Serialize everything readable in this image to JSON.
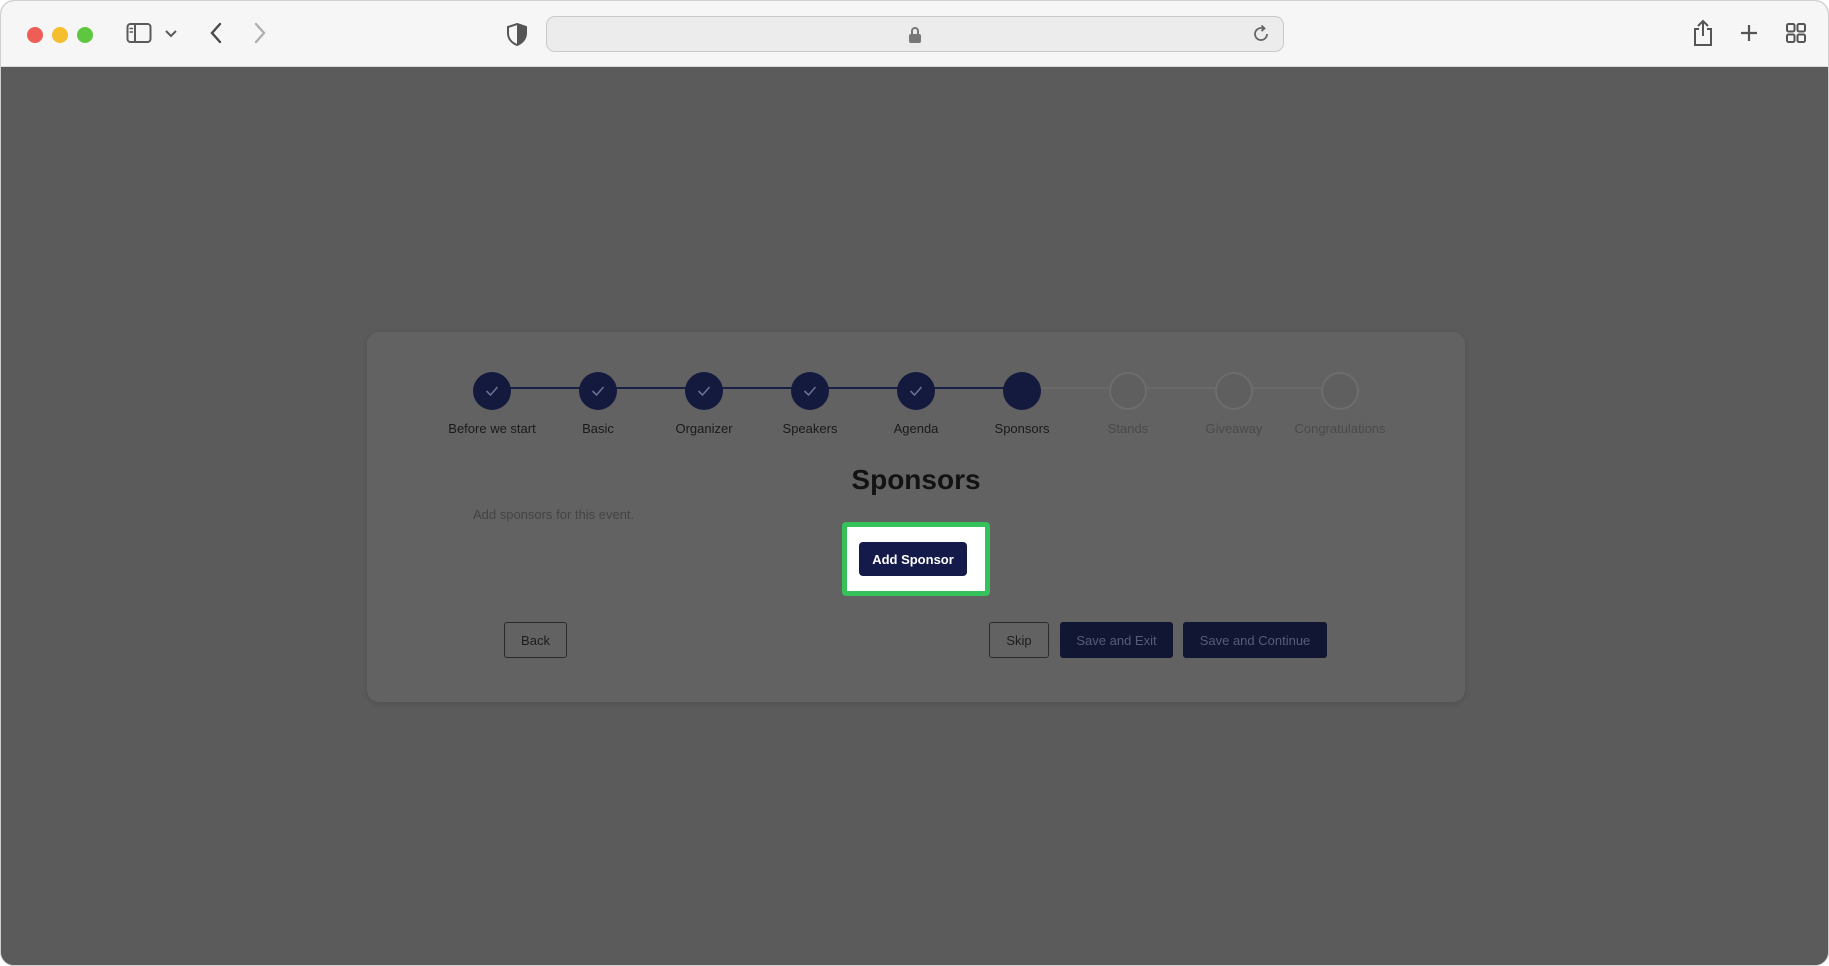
{
  "browser": {
    "icons": [
      "sidebar-icon",
      "chevron-down-icon",
      "back-arrow-icon",
      "forward-arrow-icon",
      "shield-icon",
      "lock-icon",
      "reload-icon",
      "share-icon",
      "plus-icon",
      "tab-overview-icon"
    ],
    "traffic_light_colors": {
      "close": "#ee5e57",
      "minimize": "#f4be2f",
      "zoom": "#5fc73f"
    }
  },
  "stepper": {
    "steps": [
      {
        "label": "Before we start",
        "status": "done"
      },
      {
        "label": "Basic",
        "status": "done"
      },
      {
        "label": "Organizer",
        "status": "done"
      },
      {
        "label": "Speakers",
        "status": "done"
      },
      {
        "label": "Agenda",
        "status": "done"
      },
      {
        "label": "Sponsors",
        "status": "current"
      },
      {
        "label": "Stands",
        "status": "todo"
      },
      {
        "label": "Giveaway",
        "status": "todo"
      },
      {
        "label": "Congratulations",
        "status": "todo"
      }
    ]
  },
  "main": {
    "title": "Sponsors",
    "subtitle": "Add sponsors for this event.",
    "add_sponsor_label": "Add Sponsor"
  },
  "actions": {
    "back_label": "Back",
    "skip_label": "Skip",
    "save_exit_label": "Save and Exit",
    "save_continue_label": "Save and Continue"
  },
  "colors": {
    "primary": "#141a4a",
    "highlight": "#36c25a",
    "overlay": "#5b5b5b"
  }
}
